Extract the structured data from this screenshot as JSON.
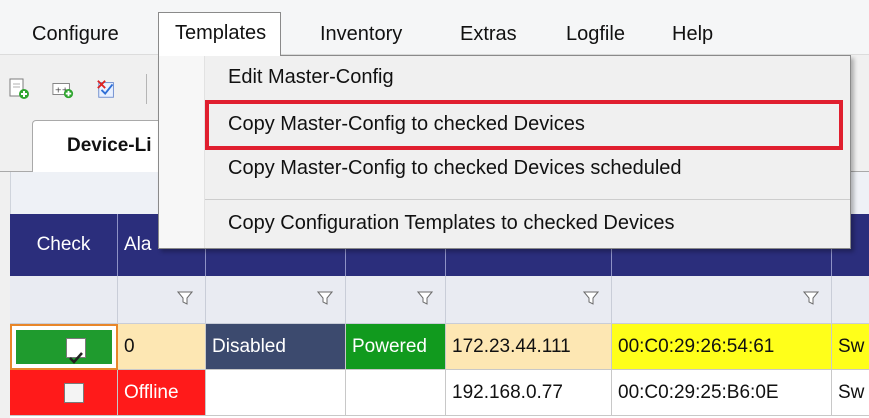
{
  "menubar": {
    "items": [
      "Configure",
      "Templates",
      "Inventory",
      "Extras",
      "Logfile",
      "Help"
    ]
  },
  "toolbar": {
    "icons": [
      "new-device-icon",
      "add-devices-icon",
      "import-devices-icon"
    ]
  },
  "tabs": {
    "device_list_label": "Device-Li"
  },
  "templates_menu": {
    "items": [
      "Edit Master-Config",
      "Copy Master-Config to checked Devices",
      "Copy Master-Config to checked Devices scheduled",
      "Copy Configuration Templates to checked Devices"
    ],
    "highlighted_index": 1,
    "highlight_color": "#e01f2f"
  },
  "grid": {
    "headers": {
      "check": "Check",
      "alarms": "Ala"
    },
    "rows": [
      {
        "checked": true,
        "alarms": "0",
        "redundancy": "Disabled",
        "poe": "Powered",
        "ip": "172.23.44.111",
        "mac": "00:C0:29:26:54:61",
        "next": "Sw"
      },
      {
        "checked": false,
        "alarms": "Offline",
        "redundancy": "",
        "poe": "",
        "ip": "192.168.0.77",
        "mac": "00:C0:29:25:B6:0E",
        "next": "Sw"
      }
    ]
  },
  "colors": {
    "header_bg": "#2b2e7c",
    "check_ok": "#1f9b2e",
    "offline": "#ff1a1a",
    "alarm_ok": "#fde7b3",
    "disabled_bg": "#3c4a6e",
    "powered_bg": "#119a1e",
    "ip_bg": "#fde7b3",
    "mac_bg": "#ffff1a"
  }
}
